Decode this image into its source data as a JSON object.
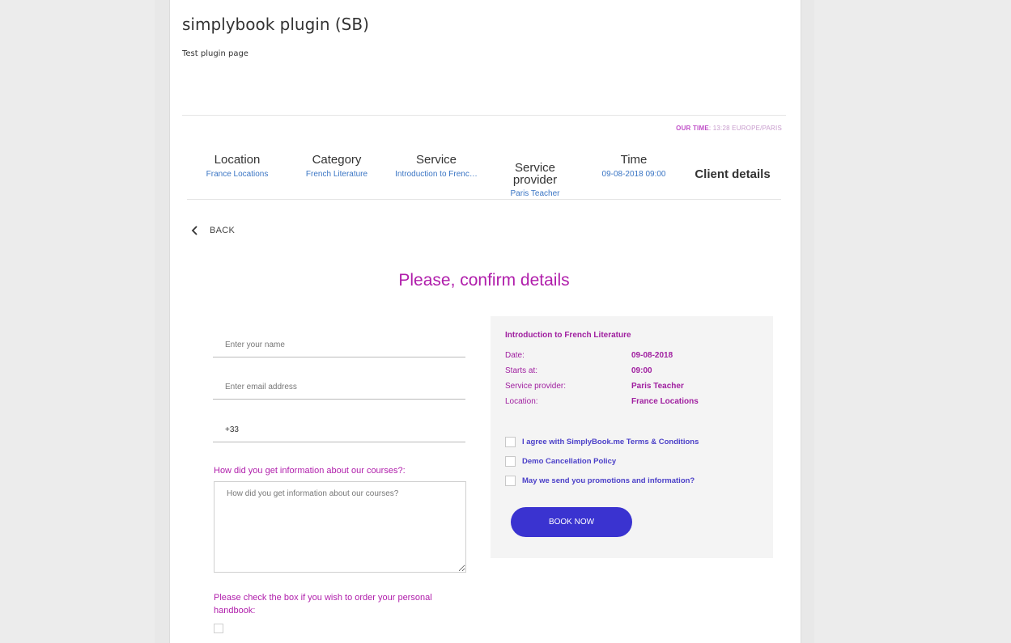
{
  "page": {
    "title": "simplybook plugin (SB)",
    "subtitle": "Test plugin page"
  },
  "our_time": {
    "label": "OUR TIME",
    "value": "13:28 EUROPE/PARIS"
  },
  "steps": [
    {
      "title": "Location",
      "value": "France Locations"
    },
    {
      "title": "Category",
      "value": "French Literature"
    },
    {
      "title": "Service",
      "value": "Introduction to Frenc…"
    },
    {
      "title": "Service provider",
      "value": "Paris Teacher"
    },
    {
      "title": "Time",
      "value": "09-08-2018 09:00"
    },
    {
      "title": "Client details",
      "value": ""
    }
  ],
  "back_label": "BACK",
  "confirm_title": "Please, confirm details",
  "form": {
    "name_placeholder": "Enter your name",
    "email_placeholder": "Enter email address",
    "phone_value": "+33",
    "question_label": "How did you get information about our courses?:",
    "question_placeholder": "How did you get information about our courses?",
    "handbook_label": "Please check the box if you wish to order your personal handbook:"
  },
  "summary": {
    "service": "Introduction to French Literature",
    "rows": [
      {
        "key": "Date:",
        "value": "09-08-2018"
      },
      {
        "key": "Starts at:",
        "value": "09:00"
      },
      {
        "key": "Service provider:",
        "value": "Paris Teacher"
      },
      {
        "key": "Location:",
        "value": "France Locations"
      }
    ],
    "checks": [
      "I agree with SimplyBook.me Terms & Conditions",
      "Demo Cancellation Policy",
      "May we send you promotions and information?"
    ],
    "book_label": "BOOK NOW"
  }
}
